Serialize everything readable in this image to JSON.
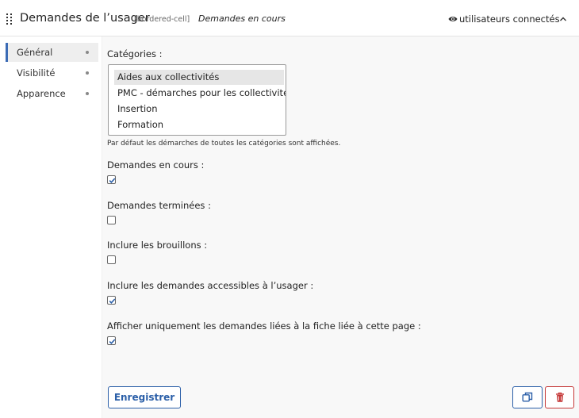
{
  "header": {
    "title": "Demandes de l’usager",
    "tag": "[bordered-cell]",
    "subtitle": "Demandes en cours",
    "visibility_label": "utilisateurs connectés"
  },
  "tabs": [
    {
      "label": "Général",
      "active": true
    },
    {
      "label": "Visibilité",
      "active": false
    },
    {
      "label": "Apparence",
      "active": false
    }
  ],
  "form": {
    "categories_label": "Catégories :",
    "categories": [
      {
        "label": "Aides aux collectivités",
        "selected": true
      },
      {
        "label": "PMC - démarches pour les collectivités",
        "selected": false
      },
      {
        "label": "Insertion",
        "selected": false
      },
      {
        "label": "Formation",
        "selected": false
      }
    ],
    "categories_hint": "Par défaut les démarches de toutes les catégories sont affichées.",
    "checkboxes": [
      {
        "label": "Demandes en cours :",
        "checked": true
      },
      {
        "label": "Demandes terminées :",
        "checked": false
      },
      {
        "label": "Inclure les brouillons :",
        "checked": false
      },
      {
        "label": "Inclure les demandes accessibles à l’usager :",
        "checked": true
      },
      {
        "label": "Afficher uniquement les demandes liées à la fiche liée à cette page :",
        "checked": true
      }
    ]
  },
  "actions": {
    "save_label": "Enregistrer",
    "duplicate_icon": "duplicate-icon",
    "delete_icon": "trash-icon"
  },
  "colors": {
    "accent": "#2b5fa8",
    "danger": "#c43535",
    "active_tab_bar": "#3b6bb5"
  }
}
